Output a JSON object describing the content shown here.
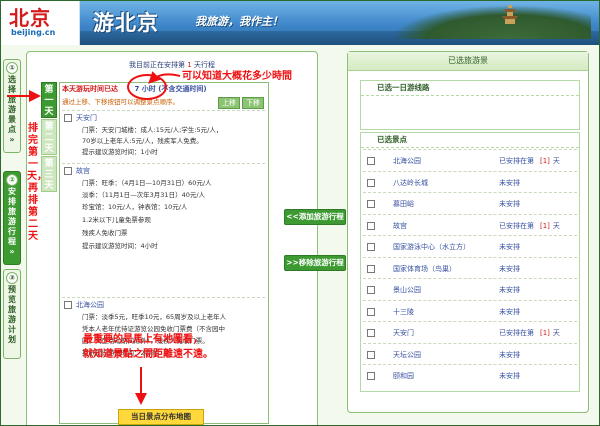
{
  "banner": {
    "logo_cn": "北京",
    "logo_url": "beijing.cn",
    "title": "游北京",
    "slogan": "我旅游，我作主！"
  },
  "steps": [
    {
      "num": "①",
      "label": "选择旅游景点"
    },
    {
      "num": "②",
      "label": "安排旅游行程"
    },
    {
      "num": "③",
      "label": "预览旅游计划"
    }
  ],
  "status": {
    "prefix": "我目前正在安排第",
    "day": "1",
    "suffix": "天行程"
  },
  "day_tabs": [
    "第一天",
    "第二天",
    "第三天"
  ],
  "day_header": {
    "label": "本天游玩时间已达",
    "value": "7 小时",
    "note": "(不含交通时间)",
    "tip": "通过上移、下移按钮可以调整景点顺序。",
    "up_btn": "上移",
    "down_btn": "下移"
  },
  "spots": [
    {
      "name": "天安门",
      "lines": [
        "门票：天安门城楼：成人:15元/人;学生:5元/人，",
        "70岁以上老年人:5元/人，残疾军人免费。",
        "提示建议游览时间：1小时"
      ]
    },
    {
      "name": "故宫",
      "lines": [
        "门票：旺季：（4月1日—10月31日）60元/人",
        "淡季：（11月1日—次年3月31日）40元/人",
        "珍宝馆：10元/人，钟表馆：10元/人",
        "1.2米以下儿童免票参观",
        "残疾人免收门票",
        "提示建议游览时间：4小时"
      ]
    },
    {
      "name": "北海公园",
      "lines": [
        "门票：淡季5元，旺季10元，65周岁及以上老年人",
        "凭本人老年优待证游览公园免收门票费（不含园中",
        "园，大型活动期间除外），残疾人免收门票。",
        "提示建议游览时间：2小时"
      ]
    }
  ],
  "map_button": "当日景点分布地图",
  "mid_buttons": {
    "add": "<<添加旅游行程",
    "remove": ">>移除旅游行程"
  },
  "right_panel": {
    "title": "已选旅游景",
    "route_title": "已选一日游线路",
    "spots_title": "已选景点",
    "rows": [
      {
        "name": "北海公园",
        "status": "已安排在第",
        "day": "[1]",
        "unit": "天"
      },
      {
        "name": "八达岭长城",
        "status": "未安排"
      },
      {
        "name": "慕田峪",
        "status": "未安排"
      },
      {
        "name": "故宫",
        "status": "已安排在第",
        "day": "[1]",
        "unit": "天"
      },
      {
        "name": "国家游泳中心（水立方）",
        "status": "未安排"
      },
      {
        "name": "国家体育场（鸟巢）",
        "status": "未安排"
      },
      {
        "name": "景山公园",
        "status": "未安排"
      },
      {
        "name": "十三陵",
        "status": "未安排"
      },
      {
        "name": "天安门",
        "status": "已安排在第",
        "day": "[1]",
        "unit": "天"
      },
      {
        "name": "天坛公园",
        "status": "未安排"
      },
      {
        "name": "颐和园",
        "status": "未安排"
      }
    ]
  },
  "annotations": {
    "top": "可以知道大概花多少時間",
    "side": "排完第一天，再排第二天",
    "bottom_1": "最重要的是馬上有地圖看，",
    "bottom_2": "就知道景點之間距離遠不遠。"
  }
}
